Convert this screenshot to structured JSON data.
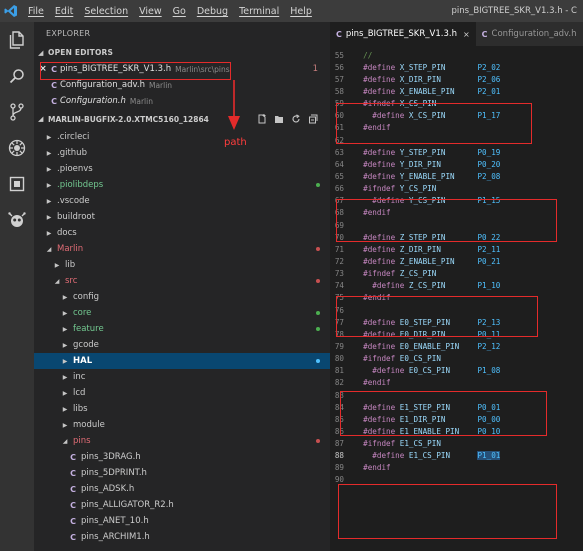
{
  "titlebar": {
    "menu": [
      "File",
      "Edit",
      "Selection",
      "View",
      "Go",
      "Debug",
      "Terminal",
      "Help"
    ],
    "window_title": "pins_BIGTREE_SKR_V1.3.h - C"
  },
  "activity_bar": [
    "files-icon",
    "search-icon",
    "source-control-icon",
    "debug-icon",
    "extensions-icon",
    "alien-icon"
  ],
  "explorer": {
    "title": "EXPLORER",
    "open_editors": {
      "header": "OPEN EDITORS",
      "items": [
        {
          "name": "pins_BIGTREE_SKR_V1.3.h",
          "path": "Marlin\\src\\pins",
          "badge": "1",
          "italic": false,
          "close": "×"
        },
        {
          "name": "Configuration_adv.h",
          "path": "Marlin",
          "badge": "",
          "italic": false,
          "close": ""
        },
        {
          "name": "Configuration.h",
          "path": "Marlin",
          "badge": "",
          "italic": true,
          "close": ""
        }
      ]
    },
    "folder": {
      "header": "MARLIN-BUGFIX-2.0.XTMC5160_12864",
      "tree": [
        {
          "label": ".circleci",
          "indent": 1,
          "type": "folder",
          "open": false,
          "color": "",
          "dot": ""
        },
        {
          "label": ".github",
          "indent": 1,
          "type": "folder",
          "open": false,
          "color": "",
          "dot": ""
        },
        {
          "label": ".pioenvs",
          "indent": 1,
          "type": "folder",
          "open": false,
          "color": "",
          "dot": ""
        },
        {
          "label": ".piolibdeps",
          "indent": 1,
          "type": "folder",
          "open": false,
          "color": "green",
          "dot": "#4caf50"
        },
        {
          "label": ".vscode",
          "indent": 1,
          "type": "folder",
          "open": false,
          "color": "",
          "dot": ""
        },
        {
          "label": "buildroot",
          "indent": 1,
          "type": "folder",
          "open": false,
          "color": "",
          "dot": ""
        },
        {
          "label": "docs",
          "indent": 1,
          "type": "folder",
          "open": false,
          "color": "",
          "dot": ""
        },
        {
          "label": "Marlin",
          "indent": 1,
          "type": "folder",
          "open": true,
          "color": "red",
          "dot": "#c75050"
        },
        {
          "label": "lib",
          "indent": 2,
          "type": "folder",
          "open": false,
          "color": "",
          "dot": ""
        },
        {
          "label": "src",
          "indent": 2,
          "type": "folder",
          "open": true,
          "color": "red",
          "dot": "#c75050"
        },
        {
          "label": "config",
          "indent": 3,
          "type": "folder",
          "open": false,
          "color": "",
          "dot": ""
        },
        {
          "label": "core",
          "indent": 3,
          "type": "folder",
          "open": false,
          "color": "green",
          "dot": "#4caf50"
        },
        {
          "label": "feature",
          "indent": 3,
          "type": "folder",
          "open": false,
          "color": "green",
          "dot": "#4caf50"
        },
        {
          "label": "gcode",
          "indent": 3,
          "type": "folder",
          "open": false,
          "color": "",
          "dot": ""
        },
        {
          "label": "HAL",
          "indent": 3,
          "type": "folder",
          "open": false,
          "color": "",
          "dot": "#4fc1ff",
          "selected": true
        },
        {
          "label": "inc",
          "indent": 3,
          "type": "folder",
          "open": false,
          "color": "",
          "dot": ""
        },
        {
          "label": "lcd",
          "indent": 3,
          "type": "folder",
          "open": false,
          "color": "",
          "dot": ""
        },
        {
          "label": "libs",
          "indent": 3,
          "type": "folder",
          "open": false,
          "color": "",
          "dot": ""
        },
        {
          "label": "module",
          "indent": 3,
          "type": "folder",
          "open": false,
          "color": "",
          "dot": ""
        },
        {
          "label": "pins",
          "indent": 3,
          "type": "folder",
          "open": true,
          "color": "red",
          "dot": "#c75050"
        },
        {
          "label": "pins_3DRAG.h",
          "indent": 4,
          "type": "file",
          "open": false,
          "color": "",
          "dot": ""
        },
        {
          "label": "pins_5DPRINT.h",
          "indent": 4,
          "type": "file",
          "open": false,
          "color": "",
          "dot": ""
        },
        {
          "label": "pins_ADSK.h",
          "indent": 4,
          "type": "file",
          "open": false,
          "color": "",
          "dot": ""
        },
        {
          "label": "pins_ALLIGATOR_R2.h",
          "indent": 4,
          "type": "file",
          "open": false,
          "color": "",
          "dot": ""
        },
        {
          "label": "pins_ANET_10.h",
          "indent": 4,
          "type": "file",
          "open": false,
          "color": "",
          "dot": ""
        },
        {
          "label": "pins_ARCHIM1.h",
          "indent": 4,
          "type": "file",
          "open": false,
          "color": "",
          "dot": ""
        }
      ]
    }
  },
  "annotation": {
    "path_label": "path"
  },
  "editor": {
    "tabs": [
      {
        "label": "pins_BIGTREE_SKR_V1.3.h",
        "active": true,
        "close": "×"
      },
      {
        "label": "Configuration_adv.h",
        "active": false,
        "close": ""
      }
    ],
    "lines": [
      {
        "n": "55",
        "dir": "//",
        "mac": "",
        "val": "",
        "indent": 1,
        "comment": true
      },
      {
        "n": "56",
        "dir": "#define",
        "mac": "X_STEP_PIN",
        "val": "P2_02",
        "indent": 1
      },
      {
        "n": "57",
        "dir": "#define",
        "mac": "X_DIR_PIN",
        "val": "P2_06",
        "indent": 1
      },
      {
        "n": "58",
        "dir": "#define",
        "mac": "X_ENABLE_PIN",
        "val": "P2_01",
        "indent": 1
      },
      {
        "n": "59",
        "dir": "#ifndef",
        "mac": "X_CS_PIN",
        "val": "",
        "indent": 1
      },
      {
        "n": "60",
        "dir": "#define",
        "mac": "X_CS_PIN",
        "val": "P1_17",
        "indent": 2
      },
      {
        "n": "61",
        "dir": "#endif",
        "mac": "",
        "val": "",
        "indent": 1
      },
      {
        "n": "62",
        "dir": "",
        "mac": "",
        "val": "",
        "indent": 1
      },
      {
        "n": "63",
        "dir": "#define",
        "mac": "Y_STEP_PIN",
        "val": "P0_19",
        "indent": 1
      },
      {
        "n": "64",
        "dir": "#define",
        "mac": "Y_DIR_PIN",
        "val": "P0_20",
        "indent": 1
      },
      {
        "n": "65",
        "dir": "#define",
        "mac": "Y_ENABLE_PIN",
        "val": "P2_08",
        "indent": 1
      },
      {
        "n": "66",
        "dir": "#ifndef",
        "mac": "Y_CS_PIN",
        "val": "",
        "indent": 1
      },
      {
        "n": "67",
        "dir": "#define",
        "mac": "Y_CS_PIN",
        "val": "P1_15",
        "indent": 2
      },
      {
        "n": "68",
        "dir": "#endif",
        "mac": "",
        "val": "",
        "indent": 1
      },
      {
        "n": "69",
        "dir": "",
        "mac": "",
        "val": "",
        "indent": 1
      },
      {
        "n": "70",
        "dir": "#define",
        "mac": "Z_STEP_PIN",
        "val": "P0_22",
        "indent": 1
      },
      {
        "n": "71",
        "dir": "#define",
        "mac": "Z_DIR_PIN",
        "val": "P2_11",
        "indent": 1
      },
      {
        "n": "72",
        "dir": "#define",
        "mac": "Z_ENABLE_PIN",
        "val": "P0_21",
        "indent": 1
      },
      {
        "n": "73",
        "dir": "#ifndef",
        "mac": "Z_CS_PIN",
        "val": "",
        "indent": 1
      },
      {
        "n": "74",
        "dir": "#define",
        "mac": "Z_CS_PIN",
        "val": "P1_10",
        "indent": 2
      },
      {
        "n": "75",
        "dir": "#endif",
        "mac": "",
        "val": "",
        "indent": 1
      },
      {
        "n": "76",
        "dir": "",
        "mac": "",
        "val": "",
        "indent": 1
      },
      {
        "n": "77",
        "dir": "#define",
        "mac": "E0_STEP_PIN",
        "val": "P2_13",
        "indent": 1
      },
      {
        "n": "78",
        "dir": "#define",
        "mac": "E0_DIR_PIN",
        "val": "P0_11",
        "indent": 1
      },
      {
        "n": "79",
        "dir": "#define",
        "mac": "E0_ENABLE_PIN",
        "val": "P2_12",
        "indent": 1
      },
      {
        "n": "80",
        "dir": "#ifndef",
        "mac": "E0_CS_PIN",
        "val": "",
        "indent": 1
      },
      {
        "n": "81",
        "dir": "#define",
        "mac": "E0_CS_PIN",
        "val": "P1_08",
        "indent": 2
      },
      {
        "n": "82",
        "dir": "#endif",
        "mac": "",
        "val": "",
        "indent": 1
      },
      {
        "n": "83",
        "dir": "",
        "mac": "",
        "val": "",
        "indent": 1
      },
      {
        "n": "84",
        "dir": "#define",
        "mac": "E1_STEP_PIN",
        "val": "P0_01",
        "indent": 1
      },
      {
        "n": "85",
        "dir": "#define",
        "mac": "E1_DIR_PIN",
        "val": "P0_00",
        "indent": 1
      },
      {
        "n": "86",
        "dir": "#define",
        "mac": "E1_ENABLE_PIN",
        "val": "P0_10",
        "indent": 1
      },
      {
        "n": "87",
        "dir": "#ifndef",
        "mac": "E1_CS_PIN",
        "val": "",
        "indent": 1
      },
      {
        "n": "88",
        "dir": "#define",
        "mac": "E1_CS_PIN",
        "val": "P1_01",
        "indent": 2,
        "current": true,
        "highlight": true
      },
      {
        "n": "89",
        "dir": "#endif",
        "mac": "",
        "val": "",
        "indent": 1
      },
      {
        "n": "90",
        "dir": "",
        "mac": "",
        "val": "",
        "indent": 1
      }
    ]
  },
  "colors": {
    "annotation_red": "#e42b2b",
    "tab_active": "#1e1e1e",
    "selection": "#094771"
  }
}
